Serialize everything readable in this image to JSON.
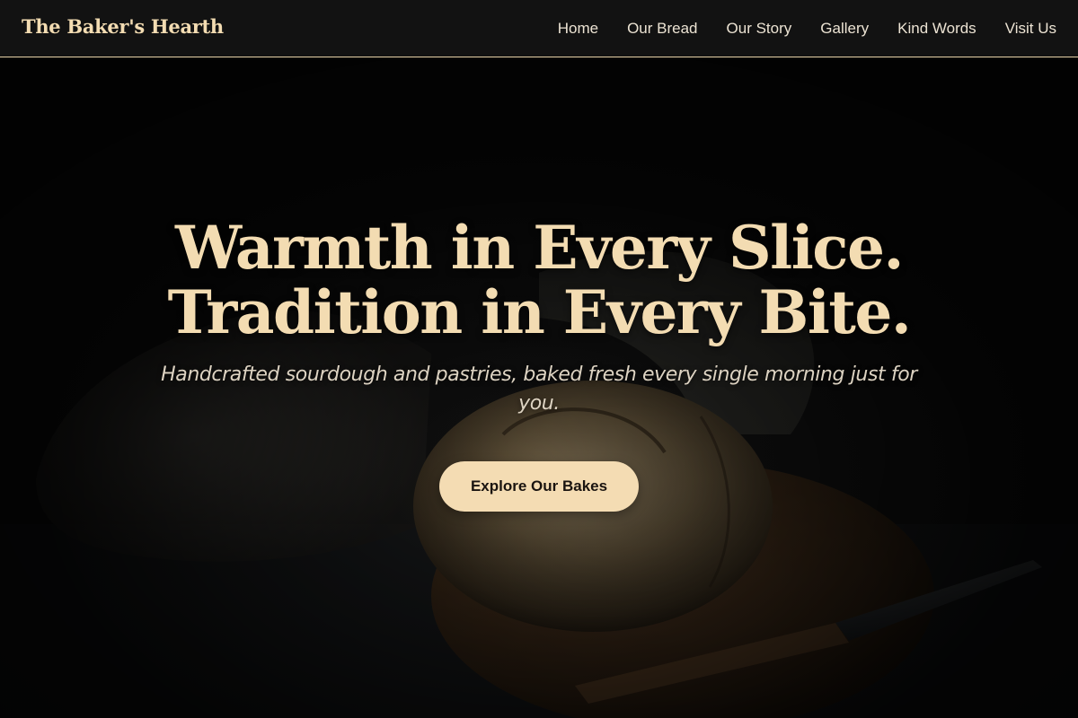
{
  "header": {
    "brand": "The Baker's Hearth",
    "nav": [
      {
        "label": "Home"
      },
      {
        "label": "Our Bread"
      },
      {
        "label": "Our Story"
      },
      {
        "label": "Gallery"
      },
      {
        "label": "Kind Words"
      },
      {
        "label": "Visit Us"
      }
    ]
  },
  "hero": {
    "title_line_1": "Warmth in Every Slice.",
    "title_line_2": "Tradition in Every Bite.",
    "tagline": "Handcrafted sourdough and pastries, baked fresh every single morning just for you.",
    "cta_label": "Explore Our Bakes",
    "background_image": "sourdough-loaf-on-cutting-board-photo"
  },
  "colors": {
    "accent": "#f4dcb2",
    "background": "#121212",
    "header_border": "#e8d2a8",
    "nav_text": "#ece3d3",
    "cta_text": "#1a1410"
  }
}
